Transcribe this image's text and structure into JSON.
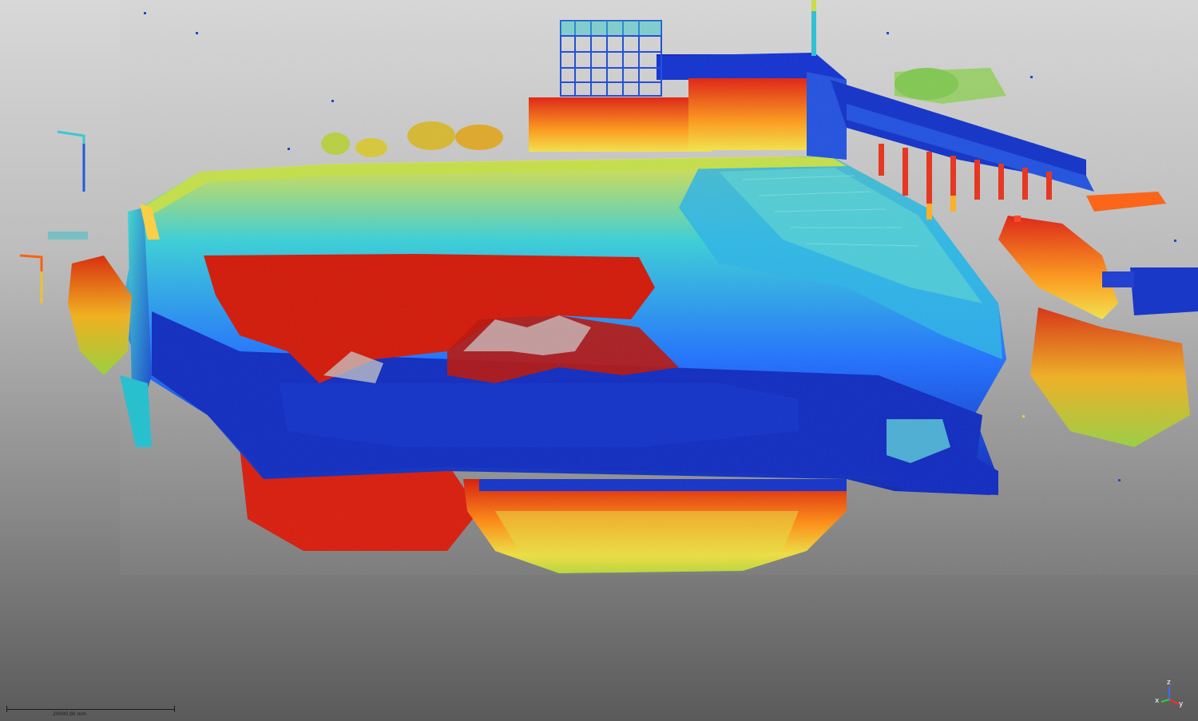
{
  "viewer": {
    "scale_bar_label": "20000.00 mm",
    "axis_labels": {
      "x": "x",
      "y": "y",
      "z": "z"
    },
    "axis_colors": {
      "x": "#ff2a2a",
      "y": "#2ad42a",
      "z": "#3a6bff"
    },
    "background": [
      "#d8d8d8",
      "#5a5a5a"
    ],
    "colormap": [
      "#0a1fb0",
      "#1e6cff",
      "#28d0d8",
      "#f0e040",
      "#ff8a10",
      "#d81808"
    ]
  }
}
